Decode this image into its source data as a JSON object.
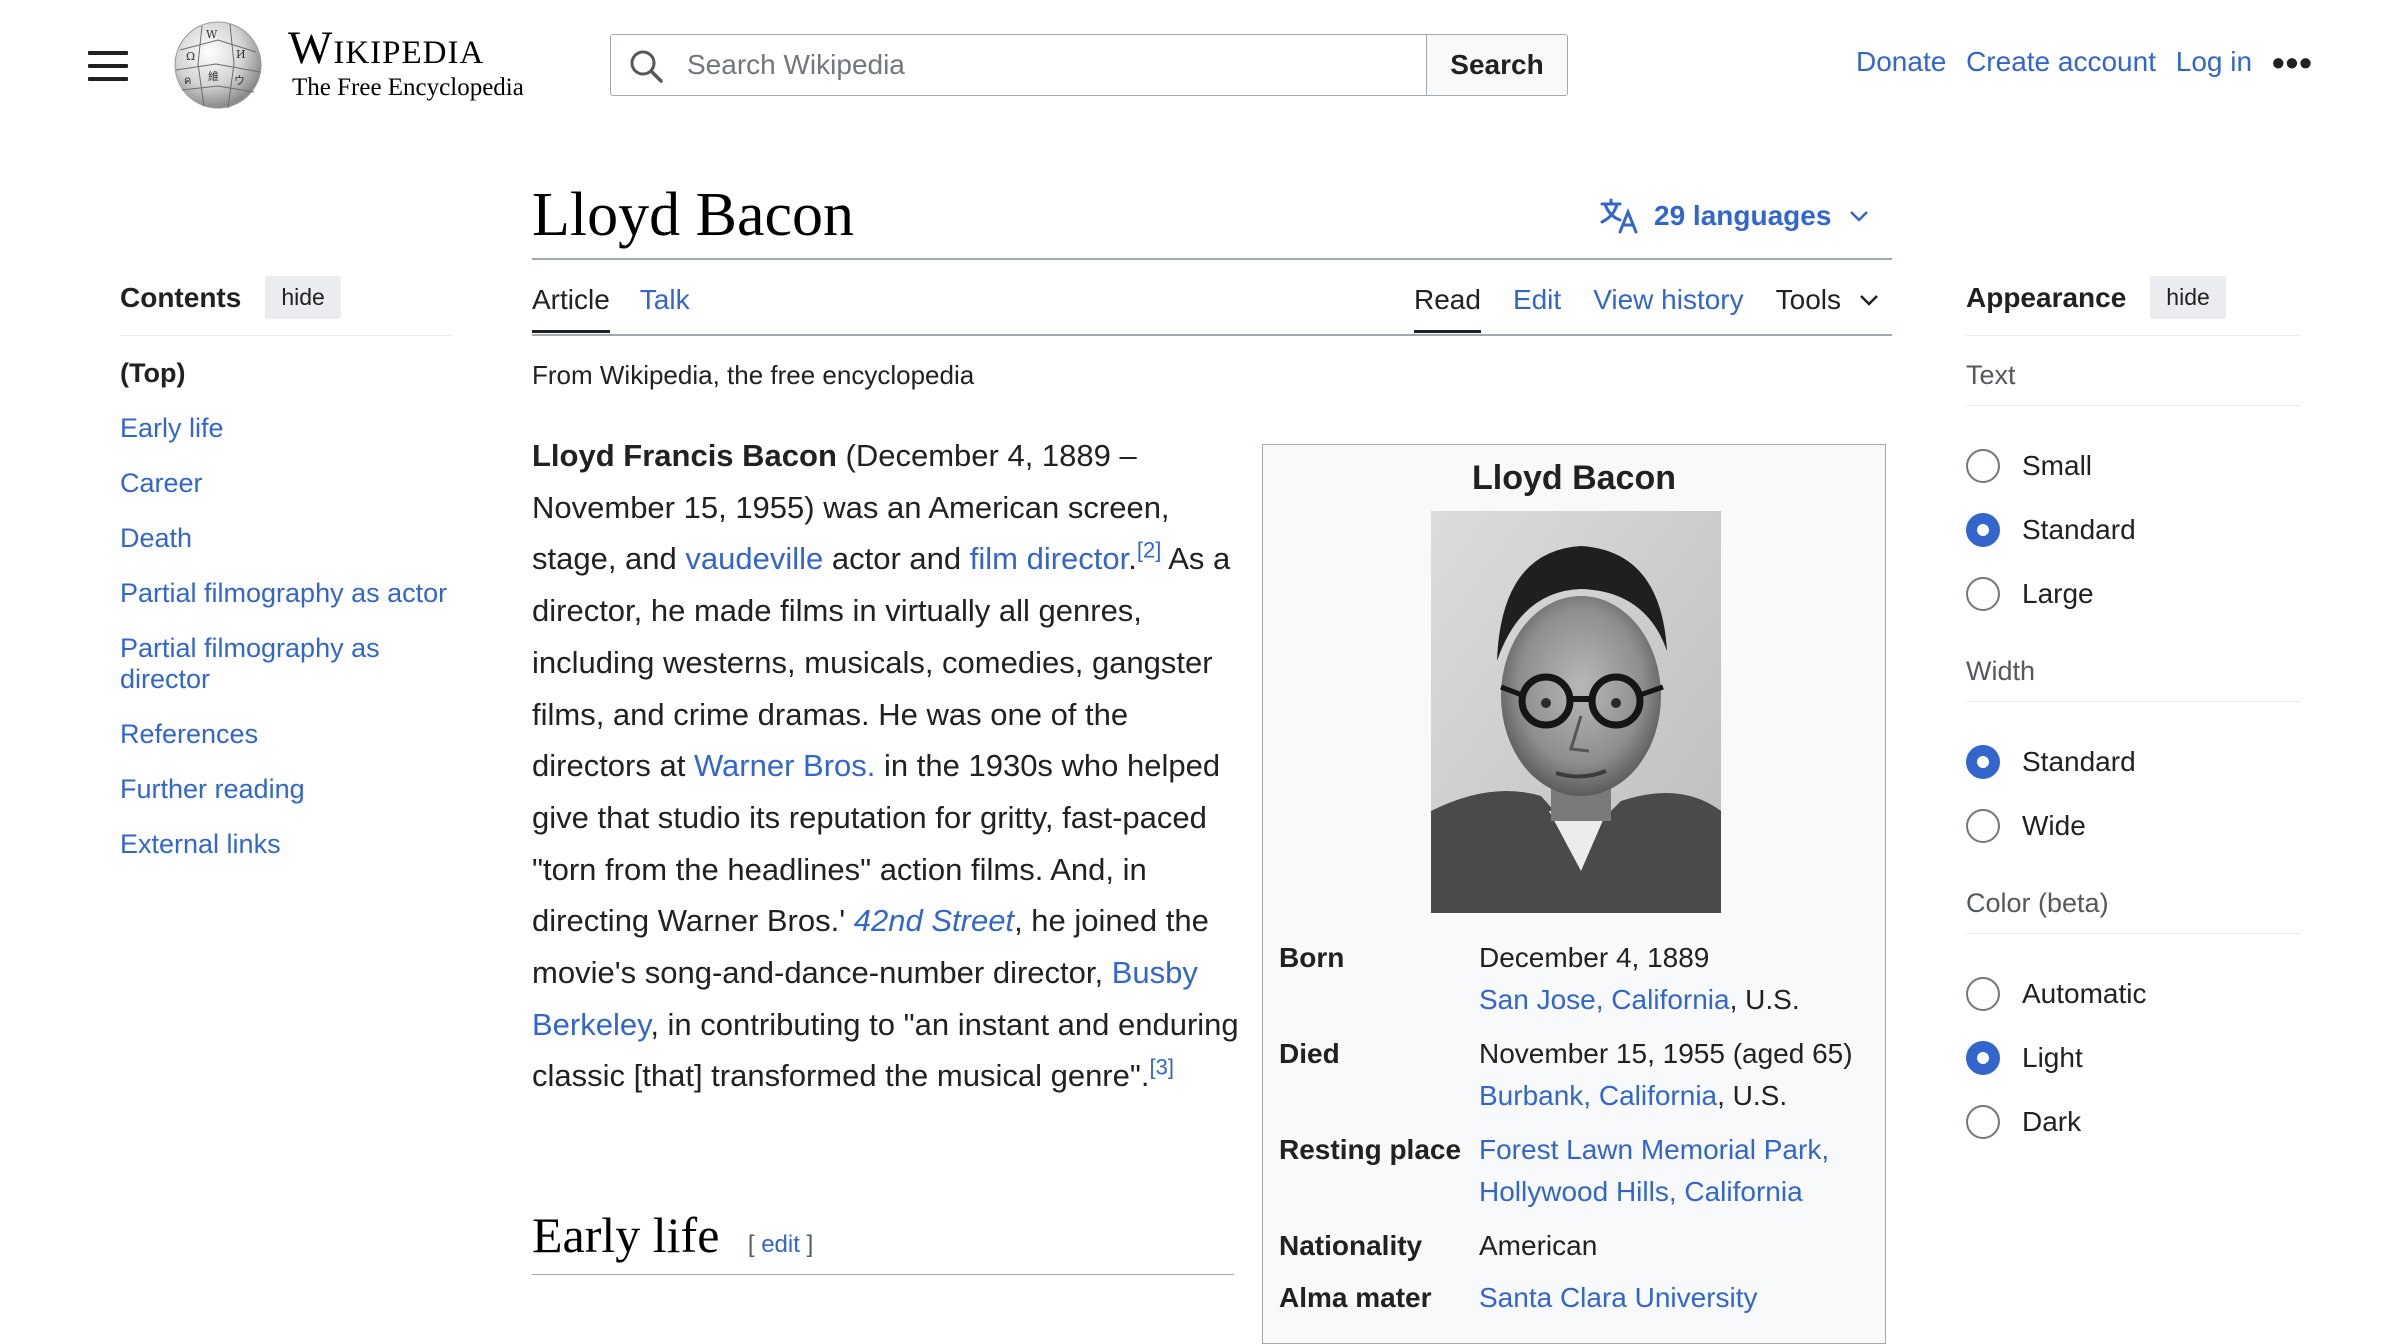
{
  "header": {
    "wordmark_title": "Wikipedia",
    "wordmark_tagline": "The Free Encyclopedia",
    "search_placeholder": "Search Wikipedia",
    "search_button": "Search",
    "user_links": [
      "Donate",
      "Create account",
      "Log in"
    ],
    "more_label": "•••"
  },
  "toc": {
    "title": "Contents",
    "hide_label": "hide",
    "items": [
      "(Top)",
      "Early life",
      "Career",
      "Death",
      "Partial filmography as actor",
      "Partial filmography as director",
      "References",
      "Further reading",
      "External links"
    ]
  },
  "article": {
    "title": "Lloyd Bacon",
    "languages": "29 languages",
    "tabs_left": [
      "Article",
      "Talk"
    ],
    "tabs_right": [
      "Read",
      "Edit",
      "View history"
    ],
    "tools_label": "Tools",
    "from_line": "From Wikipedia, the free encyclopedia",
    "intro": {
      "bold_name": "Lloyd Francis Bacon",
      "t1": " (December 4, 1889 – November 15, 1955) was an American screen, stage, and ",
      "link_vaudeville": "vaudeville",
      "t2": " actor and ",
      "link_film_director": "film director",
      "t3": ".",
      "ref2": "[2]",
      "t4": " As a director, he made films in virtually all genres, including westerns, musicals, comedies, gangster films, and crime dramas. He was one of the directors at ",
      "link_warner": "Warner Bros.",
      "t5": " in the 1930s who helped give that studio its reputation for gritty, fast-paced \"torn from the headlines\" action films. And, in directing Warner Bros.' ",
      "link_42nd": "42nd Street",
      "t6": ", he joined the movie's song-and-dance-number director, ",
      "link_busby": "Busby Berkeley",
      "t7": ", in contributing to \"an instant and enduring classic [that] transformed the musical genre\".",
      "ref3": "[3]"
    },
    "section_heading": "Early life",
    "edit_open": "[",
    "edit_label": "edit",
    "edit_close": "]"
  },
  "infobox": {
    "title": "Lloyd Bacon",
    "born_label": "Born",
    "born_date": "December 4, 1889",
    "born_place_link": "San Jose, California",
    "born_place_suffix": ", U.S.",
    "died_label": "Died",
    "died_date": "November 15, 1955 (aged 65)",
    "died_place_link": "Burbank, California",
    "died_place_suffix": ", U.S.",
    "resting_label": "Resting place",
    "resting_link": "Forest Lawn Memorial Park, Hollywood Hills, California",
    "nationality_label": "Nationality",
    "nationality_value": "American",
    "alma_label": "Alma mater",
    "alma_link": "Santa Clara University"
  },
  "appearance": {
    "title": "Appearance",
    "hide_label": "hide",
    "text_label": "Text",
    "text_options": [
      "Small",
      "Standard",
      "Large"
    ],
    "text_selected": "Standard",
    "width_label": "Width",
    "width_options": [
      "Standard",
      "Wide"
    ],
    "width_selected": "Standard",
    "color_label": "Color (beta)",
    "color_options": [
      "Automatic",
      "Light",
      "Dark"
    ],
    "color_selected": "Light"
  },
  "colors": {
    "link": "#3366cc",
    "text": "#202122",
    "border": "#a2a9b1",
    "infobox_bg": "#f8f9fa"
  }
}
